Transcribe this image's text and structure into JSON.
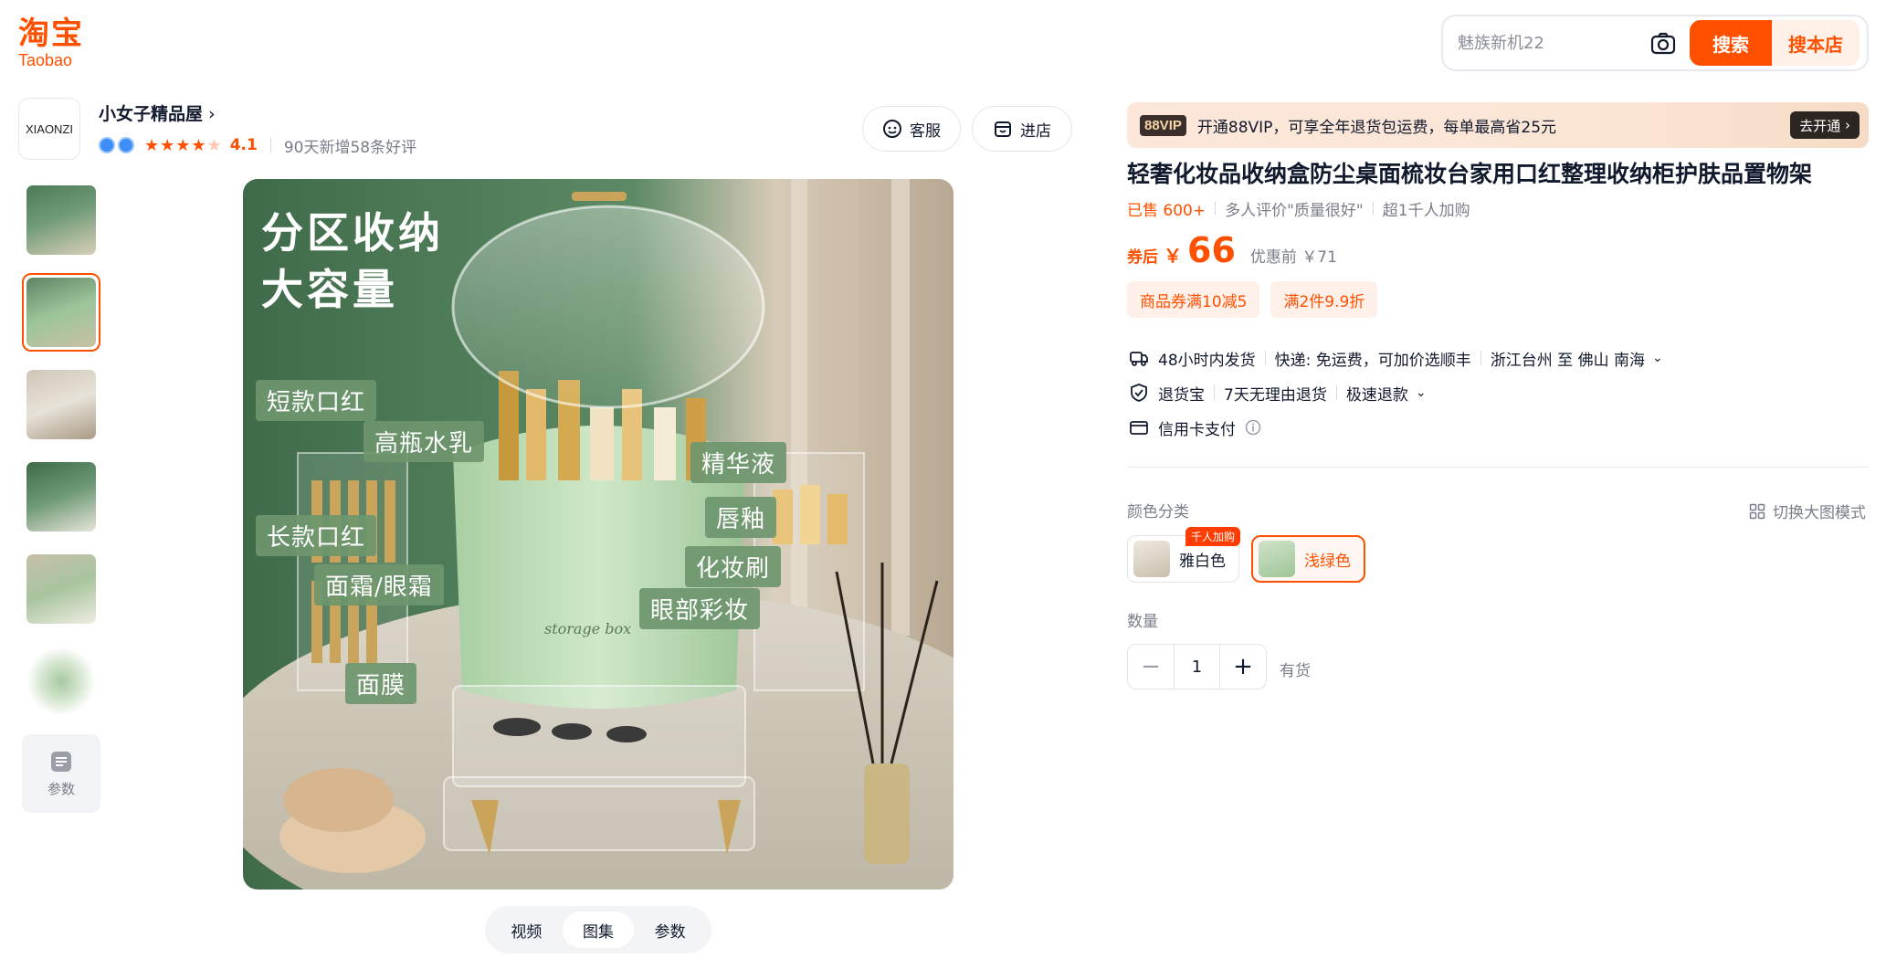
{
  "header": {
    "logo_cn": "淘宝",
    "logo_en": "Taobao",
    "search_placeholder": "魅族新机22",
    "search_button": "搜索",
    "shop_search_button": "搜本店"
  },
  "shop": {
    "logo_text": "XIAONZI",
    "name": "小女子精品屋",
    "rating": "4.1",
    "review_summary": "90天新增58条好评",
    "service_button": "客服",
    "enter_button": "进店"
  },
  "gallery": {
    "param_thumb_label": "参数",
    "caption_line1": "分区收纳",
    "caption_line2": "大容量",
    "labels": {
      "short_lipstick": "短款口红",
      "tall_bottle": "高瓶水乳",
      "serum": "精华液",
      "long_lipstick": "长款口红",
      "lip_glaze": "唇釉",
      "brush": "化妆刷",
      "cream": "面霜/眼霜",
      "eyeshadow": "眼部彩妆",
      "mask": "面膜"
    },
    "box_text": "storage box",
    "view_tabs": [
      "视频",
      "图集",
      "参数"
    ],
    "active_tab": "图集"
  },
  "vip": {
    "tag": "88VIP",
    "text": "开通88VIP，可享全年退货包运费，每单最高省25元",
    "button": "去开通"
  },
  "product": {
    "title": "轻奢化妆品收纳盒防尘桌面梳妆台家用口红整理收纳柜护肤品置物架",
    "sold": "已售 600+",
    "review_tag": "多人评价\"质量很好\"",
    "cart_count": "超1千人加购",
    "price_label": "券后",
    "price_currency": "￥",
    "price": "66",
    "orig_price": "优惠前 ￥71",
    "coupons": [
      "商品券满10减5",
      "满2件9.9折"
    ]
  },
  "delivery": {
    "ship_time": "48小时内发货",
    "express": "快递: 免运费，可加价选顺丰",
    "route": "浙江台州 至 佛山 南海",
    "return_service": "退货宝",
    "return_policy": "7天无理由退货",
    "refund": "极速退款",
    "payment": "信用卡支付"
  },
  "options": {
    "color_label": "颜色分类",
    "big_mode": "切换大图模式",
    "colors": [
      "雅白色",
      "浅绿色"
    ],
    "hot_tag": "千人加购",
    "selected_color": "浅绿色",
    "quantity_label": "数量",
    "quantity": "1",
    "stock": "有货"
  },
  "colors": {
    "accent": "#ff5000",
    "image_bg": "#5d8564"
  }
}
